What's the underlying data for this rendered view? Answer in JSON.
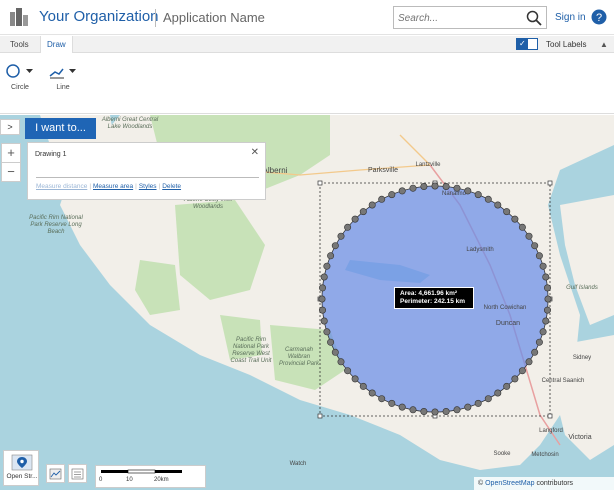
{
  "header": {
    "org_name": "Your Organization",
    "app_name": "Application Name",
    "search_placeholder": "Search...",
    "signin_label": "Sign in"
  },
  "toolbar": {
    "tabs": [
      {
        "label": "Tools"
      },
      {
        "label": "Draw"
      }
    ],
    "tool_labels_text": "Tool Labels",
    "tool_labels_checked": true,
    "buttons": [
      {
        "label": "Circle",
        "icon": "circle-icon"
      },
      {
        "label": "Line",
        "icon": "line-icon"
      }
    ]
  },
  "map_controls": {
    "i_want_to": "I want to...",
    "zoom_in": "+",
    "zoom_out": "−",
    "side_toggle": ">"
  },
  "drawing_panel": {
    "title": "Drawing 1",
    "links": [
      "Measure distance",
      "Measure area",
      "Styles",
      "Delete"
    ]
  },
  "measurement": {
    "area": "Area: 4,661.96 km²",
    "perimeter": "Perimeter: 242.15 km"
  },
  "map_labels": {
    "alberni": "Alberni",
    "great_central": "Alberni Great Central Lake Woodlands",
    "parksville": "Parksville",
    "lantzville": "Lantzville",
    "nanaimo": "Nanaimo",
    "ladysmith": "Ladysmith",
    "north_cowichan": "North Cowichan",
    "duncan": "Duncan",
    "pacific_rim": "Pacific Rim National Park Reserve Long Beach",
    "pacific_rim_wc": "Pacific Rim National Park Reserve West Coast Trail Unit",
    "alberni_utility": "Alberni Utility Inlet Woodlands",
    "carmanah": "Carmanah Walbran Provincial Park",
    "central_saanich": "Central Saanich",
    "langford": "Langford",
    "victoria": "Victoria",
    "sooke": "Sooke",
    "metchosin": "Metchosin",
    "sidney": "Sidney",
    "watch": "Watch",
    "gulf_islands": "Gulf Islands"
  },
  "scalebar": {
    "ticks": [
      "0",
      "10",
      "20km"
    ]
  },
  "basemap": {
    "label": "Open Str..."
  },
  "attribution": {
    "prefix": "© ",
    "link": "OpenStreetMap",
    "suffix": " contributors"
  },
  "colors": {
    "brand": "#1f5fa8",
    "button_blue": "#1f65b5",
    "circle_fill": "#6a8ee8",
    "water": "#aad3df",
    "land": "#f2efe9",
    "forest": "#c8e2b8"
  }
}
